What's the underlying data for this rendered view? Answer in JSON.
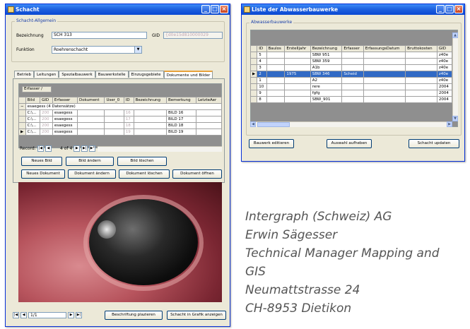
{
  "schacht": {
    "title": "Schacht",
    "group_allgemein": "Schacht-Allgemein",
    "bezeichnung_label": "Bezeichnung",
    "bezeichnung_value": "SCH 313",
    "gid_label": "GID",
    "gid_value": "{d0e15d810000029",
    "funktion_label": "Funktion",
    "funktion_value": "Roehrenschacht",
    "tabs": [
      "Betrieb",
      "Leitungen",
      "Spezialbauwerk",
      "Bauwerkstelle",
      "Einzugsgebiete",
      "Dokumente und Bilder"
    ],
    "erfasser_header": "Erfasser",
    "columns": [
      "",
      "Bild",
      "GID",
      "Erfasser",
      "Dokument",
      "User_0",
      "ID",
      "Bezeichnung",
      "Bemerkung",
      "LetzteAer"
    ],
    "group_row": "esaegess (4 Datensätze)",
    "rows": [
      {
        "bild": "C:\\...",
        "gid": "200",
        "erfasser": "esaegess",
        "id": "16",
        "bemerkung": "BILD 16"
      },
      {
        "bild": "C:\\...",
        "gid": "200",
        "erfasser": "esaegess",
        "id": "17",
        "bemerkung": "BILD 17"
      },
      {
        "bild": "C:\\...",
        "gid": "200",
        "erfasser": "esaegess",
        "id": "18",
        "bemerkung": "BILD 18"
      },
      {
        "bild": "C:\\...",
        "gid": "200",
        "erfasser": "esaegess",
        "id": "19",
        "bemerkung": "BILD 19"
      }
    ],
    "record_label": "Record:",
    "record_current": "4",
    "record_of": "of 4",
    "buttons": {
      "neues_bild": "Neues Bild",
      "bild_aendern": "Bild ändern",
      "bild_loeschen": "Bild löschen",
      "neues_dokument": "Neues Dokument",
      "dokument_aendern": "Dokument ändern",
      "dokument_loeschen": "Dokument löschen",
      "dokument_oeffnen": "Dokument öffnen",
      "beschriftung": "Beschriftung plazieren",
      "schacht_grafik": "Schacht in Grafik anzeigen"
    },
    "page_indicator": "1/1"
  },
  "liste": {
    "title": "Liste der Abwasserbauwerke",
    "group_label": "Abwasserbauwerke",
    "columns": [
      "",
      "ID",
      "Baulos",
      "Erstellj ahr",
      "Bezeichnung",
      "Erfasser",
      "ErfassungsDatum",
      "Bruttokosten",
      "GID"
    ],
    "column_display": [
      "",
      "ID",
      "Baulos",
      "Erstelljahr",
      "Bezeichnung",
      "Erfasser",
      "ErfassungsDatum",
      "Bruttokosten",
      "GID"
    ],
    "rows": [
      {
        "id": "5",
        "jahr": "",
        "bez": "SBW 951",
        "erf": "",
        "gid": "z40e"
      },
      {
        "id": "4",
        "jahr": "",
        "bez": "SBW 359",
        "erf": "",
        "gid": "z40e"
      },
      {
        "id": "3",
        "jahr": "",
        "bez": "A1b",
        "erf": "",
        "gid": "z40e"
      },
      {
        "id": "2",
        "jahr": "1975",
        "bez": "SBW 346",
        "erf": "Scheid",
        "gid": "z40e"
      },
      {
        "id": "1",
        "jahr": "",
        "bez": "A2",
        "erf": "",
        "gid": "z40e"
      },
      {
        "id": "10",
        "jahr": "",
        "bez": "rere",
        "erf": "",
        "gid": "2004"
      },
      {
        "id": "9",
        "jahr": "",
        "bez": "fgfg",
        "erf": "",
        "gid": "2004"
      },
      {
        "id": "8",
        "jahr": "",
        "bez": "SBW_901",
        "erf": "",
        "gid": "2004"
      }
    ],
    "buttons": {
      "bauwerk_editieren": "Bauwerk editieren",
      "auswahl_aufheben": "Auswahl aufheben",
      "schacht_updaten": "Schacht updaten"
    }
  },
  "contact": {
    "line1": "Intergraph (Schweiz) AG",
    "line2": "Erwin Sägesser",
    "line3": "Technical Manager Mapping and",
    "line4": "GIS",
    "line5": "Neumattstrasse 24",
    "line6": "CH-8953 Dietikon"
  }
}
